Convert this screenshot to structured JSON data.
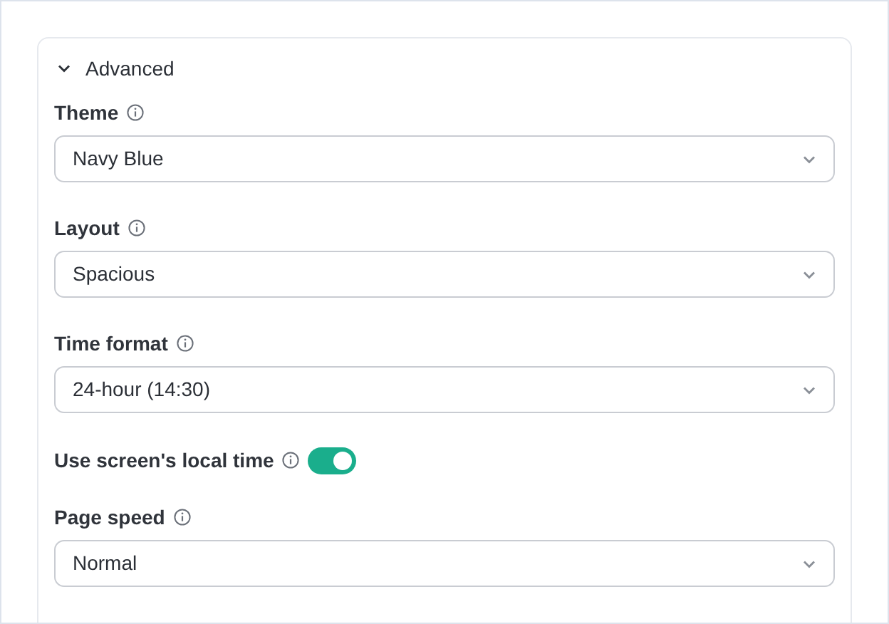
{
  "section": {
    "title": "Advanced",
    "expanded": true
  },
  "fields": [
    {
      "kind": "select",
      "label": "Theme",
      "value": "Navy Blue"
    },
    {
      "kind": "select",
      "label": "Layout",
      "value": "Spacious"
    },
    {
      "kind": "select",
      "label": "Time format",
      "value": "24-hour (14:30)"
    },
    {
      "kind": "toggle",
      "label": "Use screen's local time",
      "on": true
    },
    {
      "kind": "select",
      "label": "Page speed",
      "value": "Normal"
    }
  ]
}
